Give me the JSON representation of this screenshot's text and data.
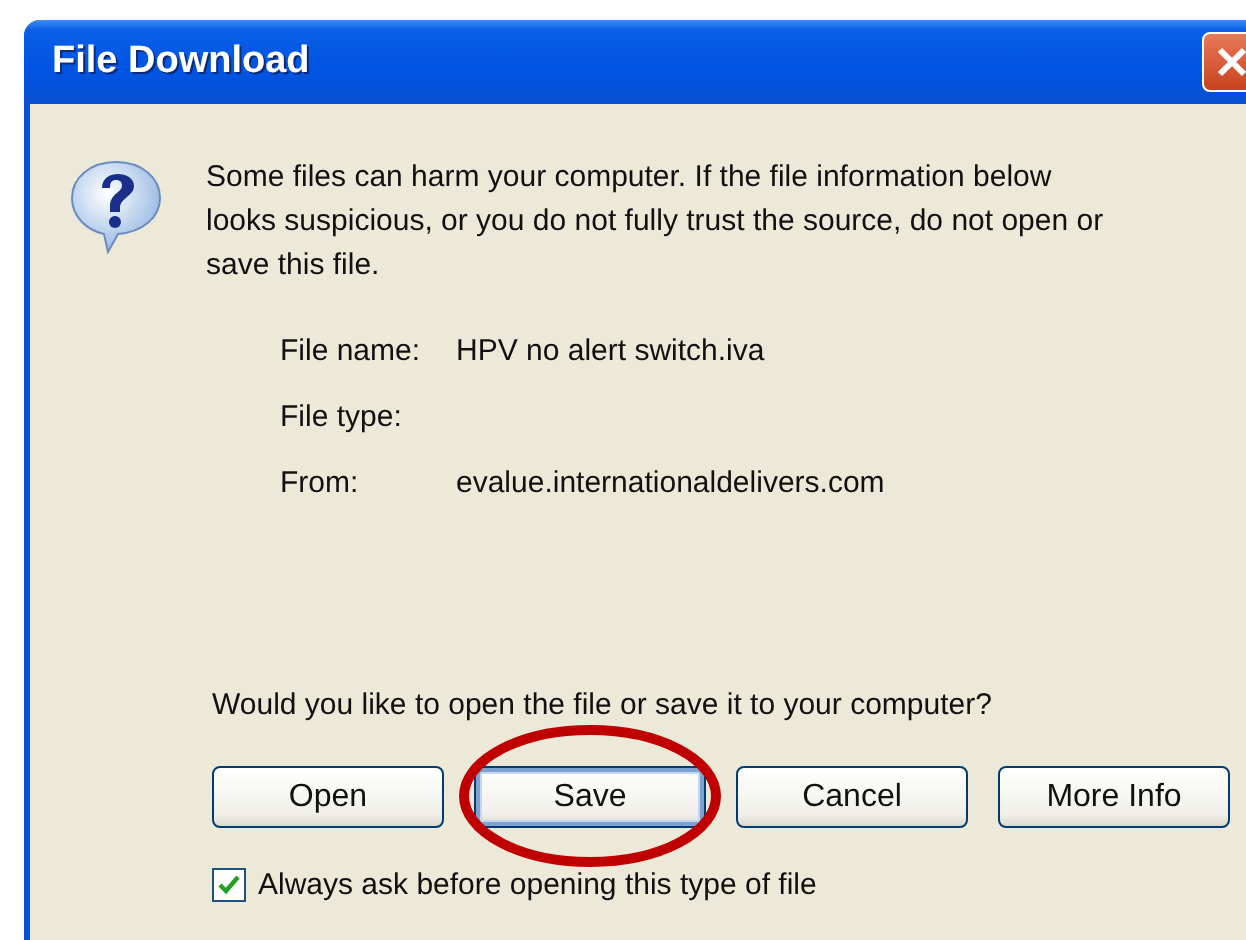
{
  "window": {
    "title": "File Download"
  },
  "message": "Some files can harm your computer. If the file information below looks suspicious, or you do not fully trust the source, do not open or save this file.",
  "details": [
    {
      "label": "File name:",
      "value": "HPV no alert switch.iva"
    },
    {
      "label": "File type:"
    },
    {
      "label": "From:",
      "value": "evalue.internationaldelivers.com"
    }
  ],
  "question": "Would you like to open the file or save it to your computer?",
  "buttons": [
    {
      "label": "Open",
      "focused": false
    },
    {
      "label": "Save",
      "focused": true
    },
    {
      "label": "Cancel",
      "focused": false
    },
    {
      "label": "More Info",
      "focused": false
    }
  ],
  "always_ask": {
    "label": "Always ask before opening this type of file",
    "checked": true
  },
  "annotation": {
    "kind": "ellipse"
  }
}
